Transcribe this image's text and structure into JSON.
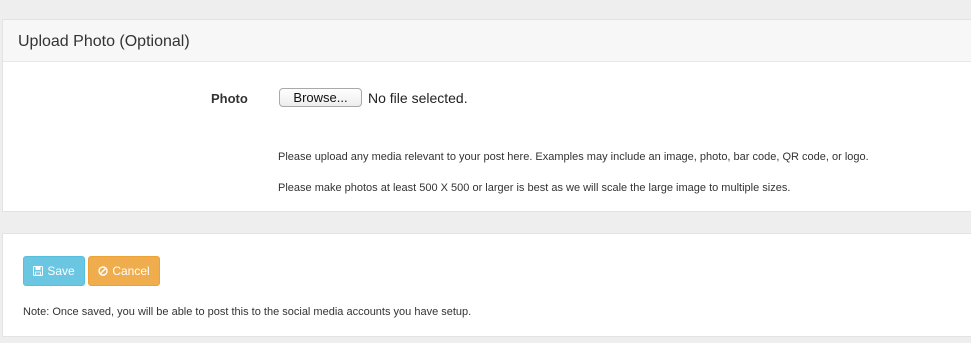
{
  "upload_panel": {
    "title": "Upload Photo (Optional)",
    "photo_label": "Photo",
    "browse_label": "Browse...",
    "file_status": "No file selected.",
    "help_lines": [
      "Please upload any media relevant to your post here. Examples may include an image, photo, bar code, QR code, or logo.",
      "Please make photos at least 500 X 500 or larger is best as we will scale the large image to multiple sizes."
    ]
  },
  "actions": {
    "save_label": "Save",
    "save_icon": "floppy-disk-icon",
    "cancel_label": "Cancel",
    "cancel_icon": "ban-icon",
    "note": "Note: Once saved, you will be able to post this to the social media accounts you have setup."
  },
  "colors": {
    "save": "#5bc0de",
    "cancel": "#f0ad4e",
    "page_bg": "#eeeeee"
  }
}
